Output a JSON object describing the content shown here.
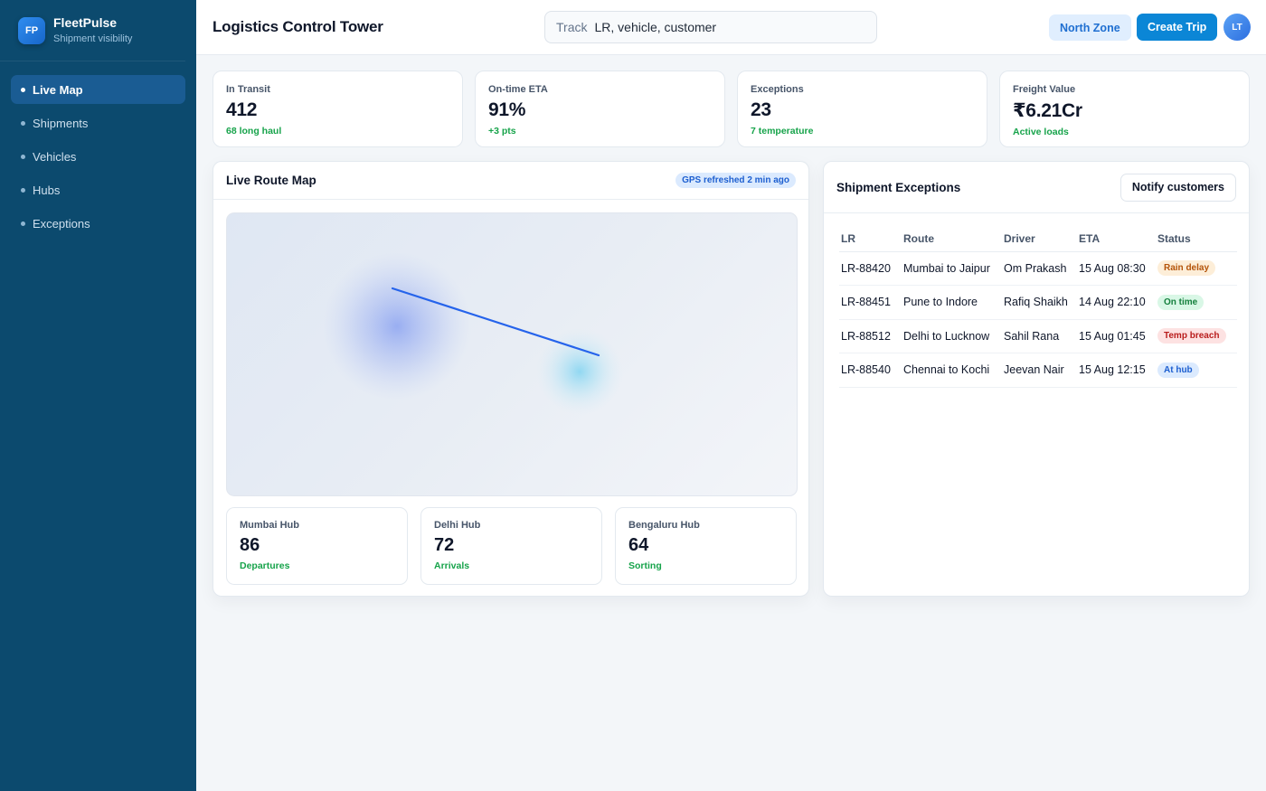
{
  "brand": {
    "logo": "FP",
    "name": "FleetPulse",
    "subtitle": "Shipment visibility"
  },
  "sidebar": {
    "items": [
      {
        "label": "Live Map",
        "active": true
      },
      {
        "label": "Shipments",
        "active": false
      },
      {
        "label": "Vehicles",
        "active": false
      },
      {
        "label": "Hubs",
        "active": false
      },
      {
        "label": "Exceptions",
        "active": false
      }
    ]
  },
  "header": {
    "title": "Logistics Control Tower",
    "search_label": "Track",
    "search_placeholder": "LR, vehicle, customer",
    "zone_label": "North Zone",
    "create_label": "Create Trip",
    "avatar": "LT"
  },
  "kpis": [
    {
      "label": "In Transit",
      "value": "412",
      "sub": "68 long haul"
    },
    {
      "label": "On-time ETA",
      "value": "91%",
      "sub": "+3 pts"
    },
    {
      "label": "Exceptions",
      "value": "23",
      "sub": "7 temperature"
    },
    {
      "label": "Freight Value",
      "value": "₹6.21Cr",
      "sub": "Active loads"
    }
  ],
  "map_panel": {
    "title": "Live Route Map",
    "badge": "GPS refreshed 2 min ago",
    "hubs": [
      {
        "name": "Mumbai Hub",
        "value": "86",
        "sub": "Departures"
      },
      {
        "name": "Delhi Hub",
        "value": "72",
        "sub": "Arrivals"
      },
      {
        "name": "Bengaluru Hub",
        "value": "64",
        "sub": "Sorting"
      }
    ]
  },
  "exceptions": {
    "title": "Shipment Exceptions",
    "notify_label": "Notify customers",
    "columns": [
      "LR",
      "Route",
      "Driver",
      "ETA",
      "Status"
    ],
    "rows": [
      {
        "lr": "LR-88420",
        "route": "Mumbai to Jaipur",
        "driver": "Om Prakash",
        "eta": "15 Aug 08:30",
        "status": "Rain delay",
        "status_color": "#b45309",
        "status_bg": "#fdeed8"
      },
      {
        "lr": "LR-88451",
        "route": "Pune to Indore",
        "driver": "Rafiq Shaikh",
        "eta": "14 Aug 22:10",
        "status": "On time",
        "status_color": "#15803d",
        "status_bg": "#d9f7e6"
      },
      {
        "lr": "LR-88512",
        "route": "Delhi to Lucknow",
        "driver": "Sahil Rana",
        "eta": "15 Aug 01:45",
        "status": "Temp breach",
        "status_color": "#b91c1c",
        "status_bg": "#fde2e2"
      },
      {
        "lr": "LR-88540",
        "route": "Chennai to Kochi",
        "driver": "Jeevan Nair",
        "eta": "15 Aug 12:15",
        "status": "At hub",
        "status_color": "#1d5fd0",
        "status_bg": "#dbeafe"
      }
    ]
  },
  "colors": {
    "sidebar": "#0c4a6e",
    "accent": "#0b86d6",
    "positive": "#16a34a",
    "route": "#2563eb"
  }
}
